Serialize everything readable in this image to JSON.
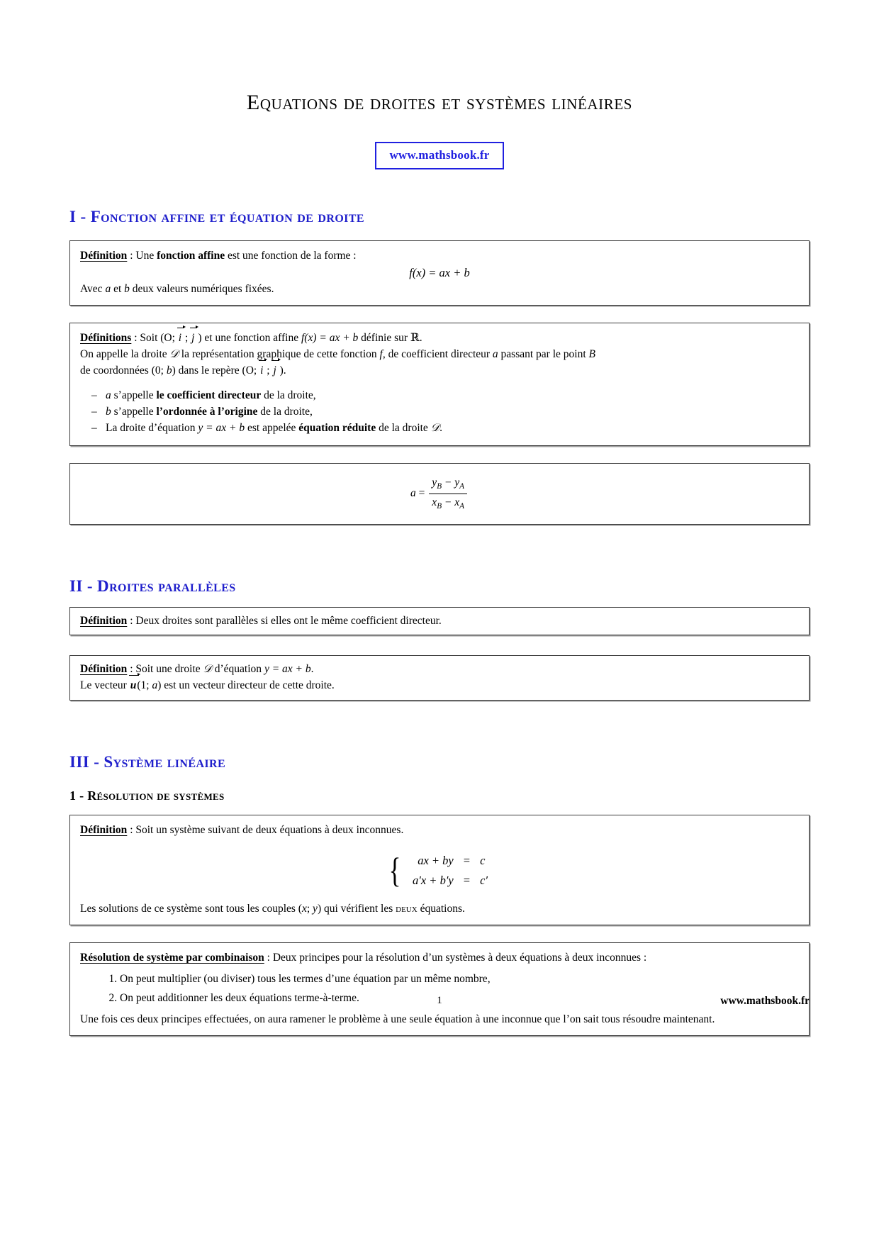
{
  "document": {
    "title": "Equations de droites et systèmes linéaires",
    "badge": "www.mathsbook.fr",
    "page_number": "1",
    "footer_site": "www.mathsbook.fr"
  },
  "sections": {
    "s1": {
      "heading": "I - Fonction affine et équation de droite",
      "box1": {
        "term": "Définition",
        "lead_after_term": " : Une ",
        "bold1": "fonction affine",
        "lead_tail": " est une fonction de la forme :",
        "formula": "f(x) = ax + b",
        "closing_prefix": "Avec ",
        "closing_var1": "a",
        "closing_mid": " et ",
        "closing_var2": "b",
        "closing_tail": " deux valeurs numériques fixées."
      },
      "box2": {
        "term": "Définitions",
        "line1_a": " : Soit (O; ",
        "line1_i": "i",
        "line1_sep": " ; ",
        "line1_j": "j",
        "line1_b": " ) et une fonction affine ",
        "line1_f": "f(x) = ax + b",
        "line1_c": " définie sur ℝ.",
        "line2_a": "On appelle la droite ",
        "line2_D": "𝒟",
        "line2_b": " la représentation graphique de cette fonction ",
        "line2_f": "f",
        "line2_c": ", de coefficient directeur ",
        "line2_a2": "a",
        "line2_d": " passant par le point ",
        "line2_B": "B",
        "line3_a": "de coordonnées (0; ",
        "line3_b": "b",
        "line3_c": ") dans le repère (O; ",
        "line3_i": "i",
        "line3_sep": " ; ",
        "line3_j": "j",
        "line3_d": " ).",
        "bullets": [
          {
            "var": "a",
            "mid": " s’appelle ",
            "bold": "le coefficient directeur",
            "tail": " de la droite,"
          },
          {
            "var": "b",
            "mid": " s’appelle ",
            "bold": "l’ordonnée à l’origine",
            "tail": " de la droite,"
          },
          {
            "var": "",
            "mid": "La droite d’équation ",
            "eq": "y = ax + b",
            "mid2": " est appelée ",
            "bold": "équation réduite",
            "tail": " de la droite ",
            "D": "𝒟",
            "end": "."
          }
        ]
      },
      "box3": {
        "lhs": "a",
        "equals": "=",
        "num_y1": "y",
        "num_y1_sub": "B",
        "num_minus": " − ",
        "num_y2": "y",
        "num_y2_sub": "A",
        "den_x1": "x",
        "den_x1_sub": "B",
        "den_minus": " − ",
        "den_x2": "x",
        "den_x2_sub": "A"
      }
    },
    "s2": {
      "heading": "II - Droites parallèles",
      "box1": {
        "term": "Définition",
        "text": " : Deux droites sont parallèles si elles ont le même coefficient directeur."
      },
      "box2": {
        "term": "Définition",
        "line1_a": " : Soit une droite ",
        "line1_D": "𝒟",
        "line1_b": " d’équation ",
        "line1_eq": "y = ax + b",
        "line1_c": ".",
        "line2_a": "Le vecteur ",
        "line2_u": "u",
        "line2_b": "(1; ",
        "line2_a_var": "a",
        "line2_c": ") est un vecteur directeur de cette droite."
      }
    },
    "s3": {
      "heading": "III - Système linéaire",
      "sub1": {
        "heading": "1 - Résolution de systèmes",
        "box1": {
          "term": "Définition",
          "text": " : Soit un système suivant de deux équations à deux inconnues.",
          "system": {
            "rows": [
              {
                "lhs": "ax + by",
                "eq": "=",
                "rhs": "c"
              },
              {
                "lhs": "a′x + b′y",
                "eq": "=",
                "rhs": "c′"
              }
            ]
          },
          "closing_a": "Les solutions de ce système sont tous les couples (",
          "closing_x": "x",
          "closing_semi": "; ",
          "closing_y": "y",
          "closing_b": ") qui vérifient les ",
          "closing_deux": "deux",
          "closing_c": " équations."
        },
        "box2": {
          "term": "Résolution de système par combinaison",
          "intro": " : Deux principes pour la résolution d’un systèmes à deux équations à deux inconnues :",
          "items": [
            "On peut multiplier (ou diviser) tous les termes d’une équation par un même nombre,",
            "On peut additionner les deux équations terme-à-terme."
          ],
          "closing": "Une fois ces deux principes effectuées, on aura ramener le problème à une seule équation à une inconnue que l’on sait tous résoudre maintenant."
        }
      }
    }
  }
}
